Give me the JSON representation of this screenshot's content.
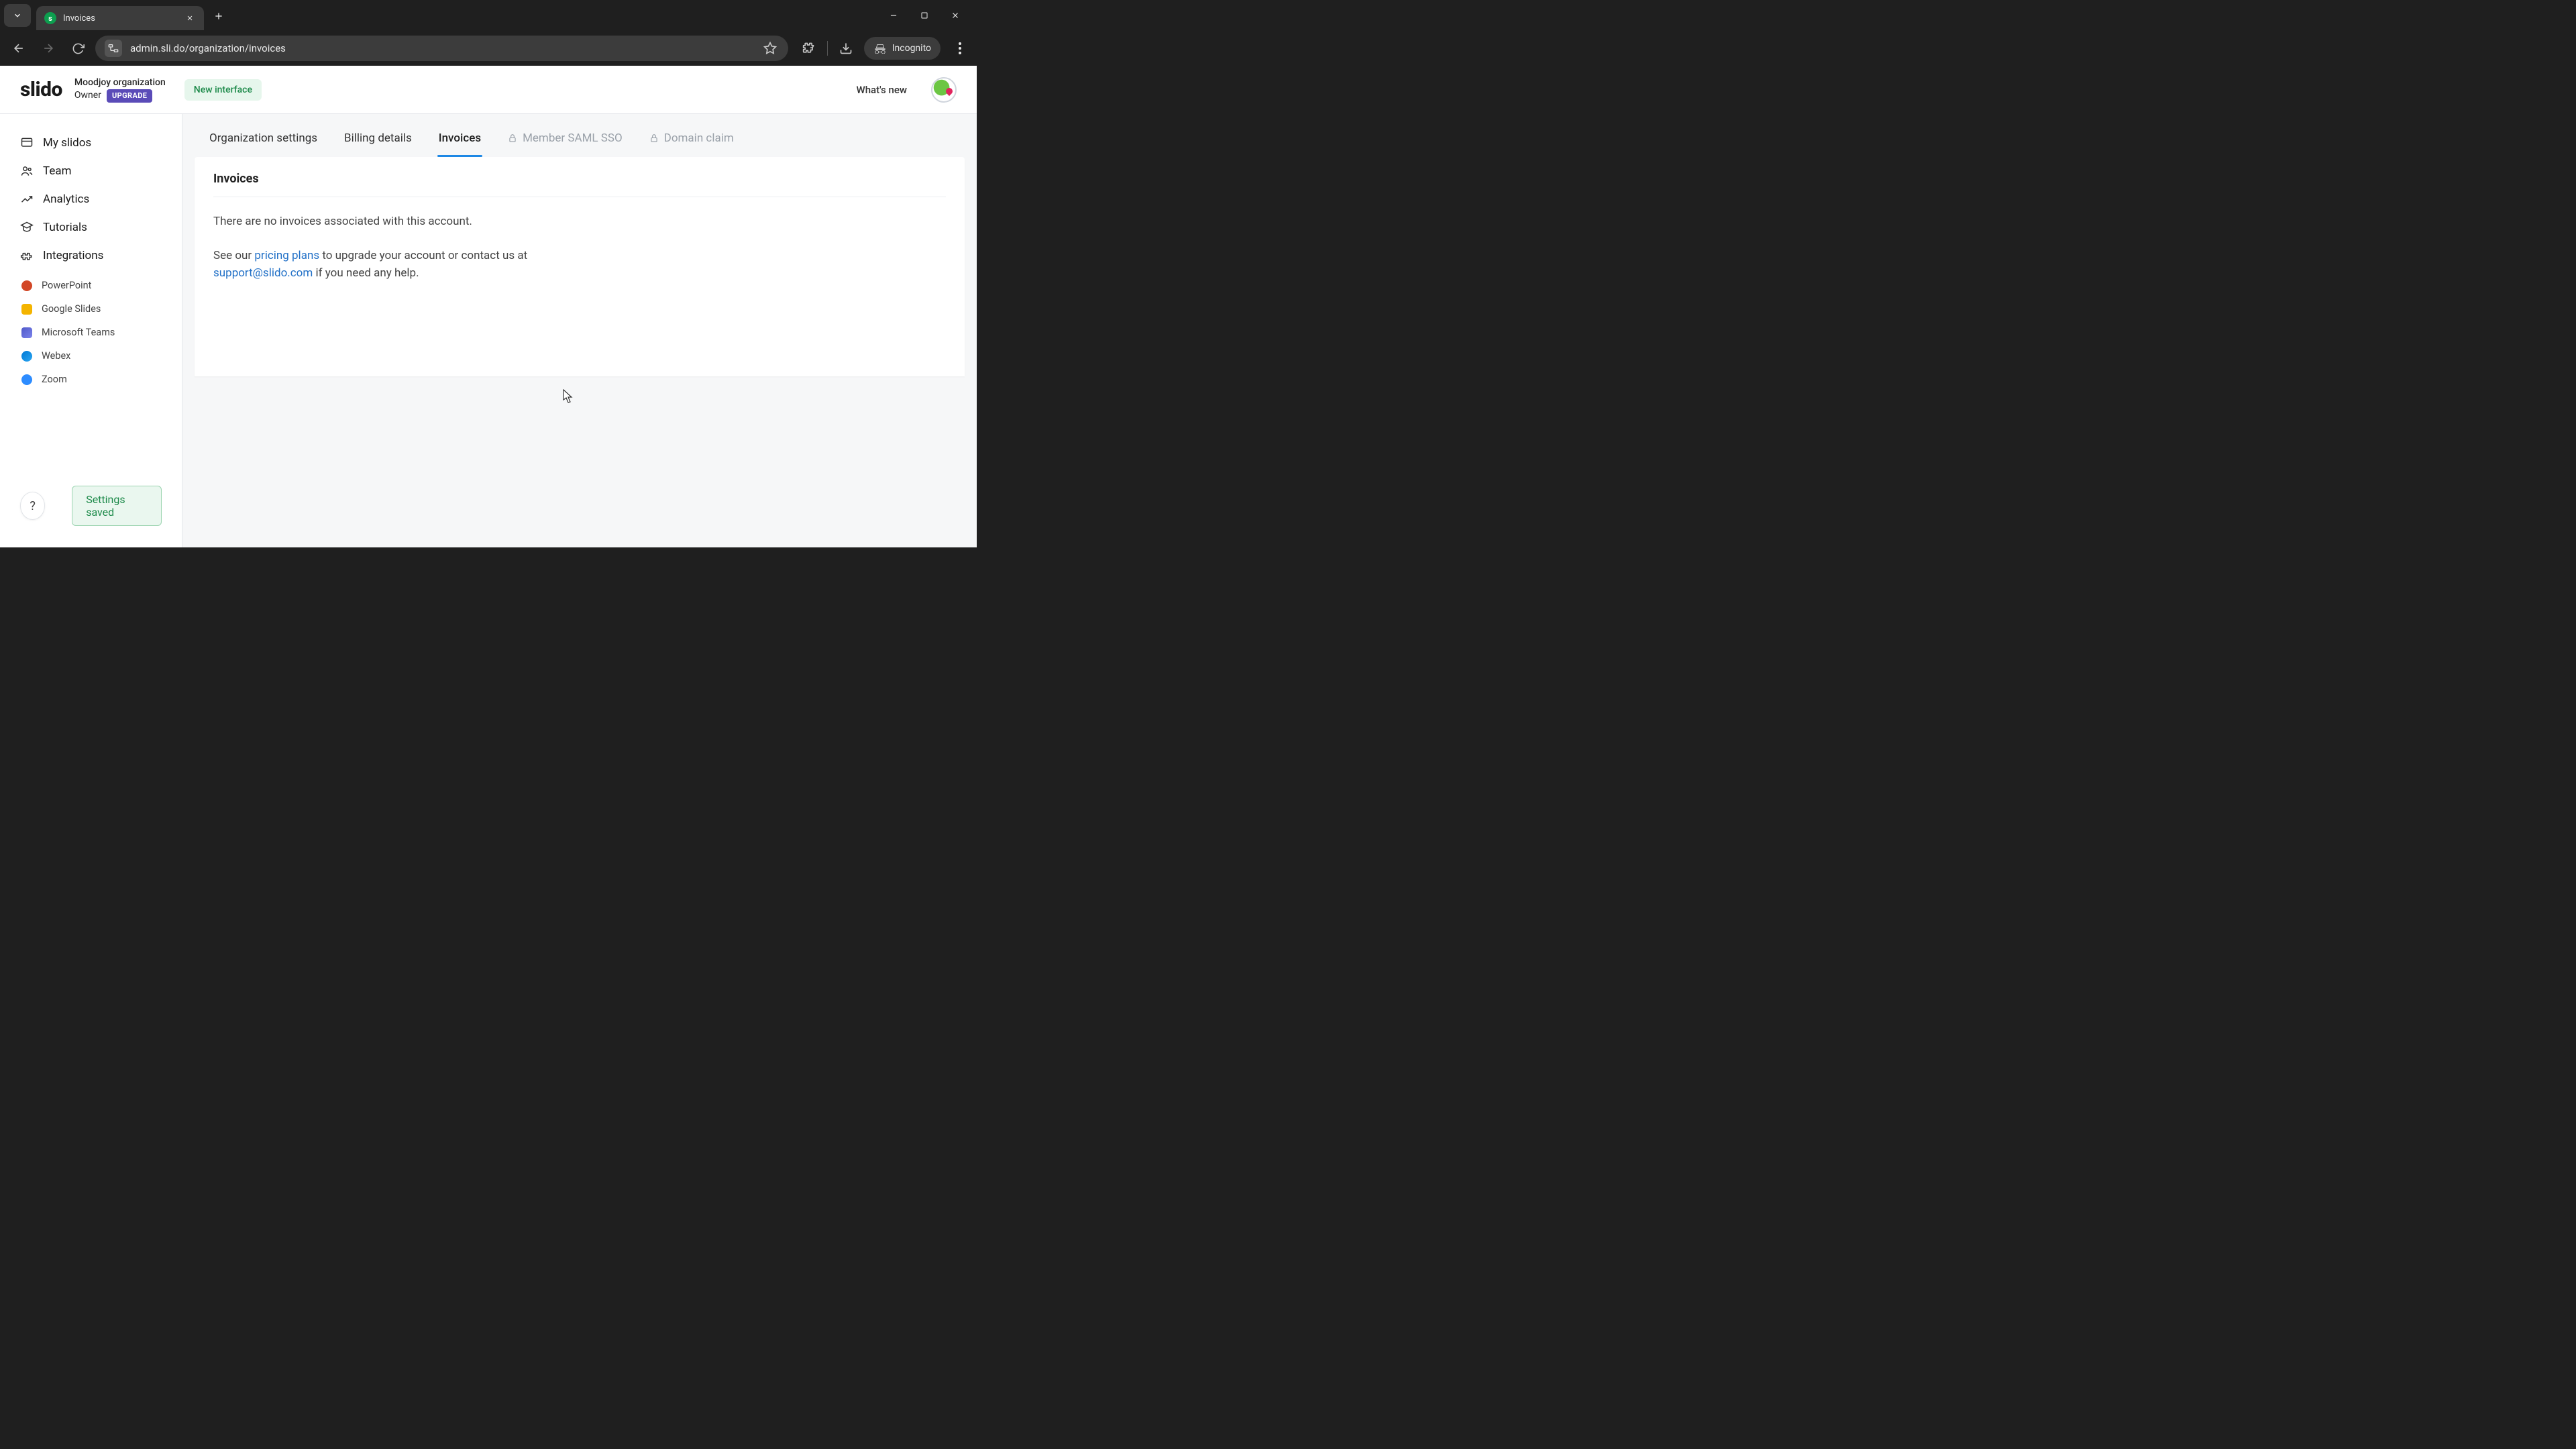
{
  "browser": {
    "tab_title": "Invoices",
    "url": "admin.sli.do/organization/invoices",
    "incognito_label": "Incognito"
  },
  "header": {
    "logo": "slido",
    "org_name": "Moodjoy organization",
    "role": "Owner",
    "upgrade_label": "UPGRADE",
    "new_interface_label": "New interface",
    "whats_new": "What's new"
  },
  "sidebar": {
    "nav": {
      "my_slidos": "My slidos",
      "team": "Team",
      "analytics": "Analytics",
      "tutorials": "Tutorials",
      "integrations": "Integrations"
    },
    "integrations": {
      "powerpoint": "PowerPoint",
      "google_slides": "Google Slides",
      "microsoft_teams": "Microsoft Teams",
      "webex": "Webex",
      "zoom": "Zoom"
    },
    "help_glyph": "?",
    "toast": "Settings saved"
  },
  "tabs": {
    "org_settings": "Organization settings",
    "billing": "Billing details",
    "invoices": "Invoices",
    "saml": "Member SAML SSO",
    "domain": "Domain claim"
  },
  "panel": {
    "title": "Invoices",
    "empty": "There are no invoices associated with this account.",
    "help_prefix": "See our ",
    "pricing_link": "pricing plans",
    "help_mid": " to upgrade your account or contact us at ",
    "support_link": "support@slido.com",
    "help_suffix": " if you need any help."
  }
}
